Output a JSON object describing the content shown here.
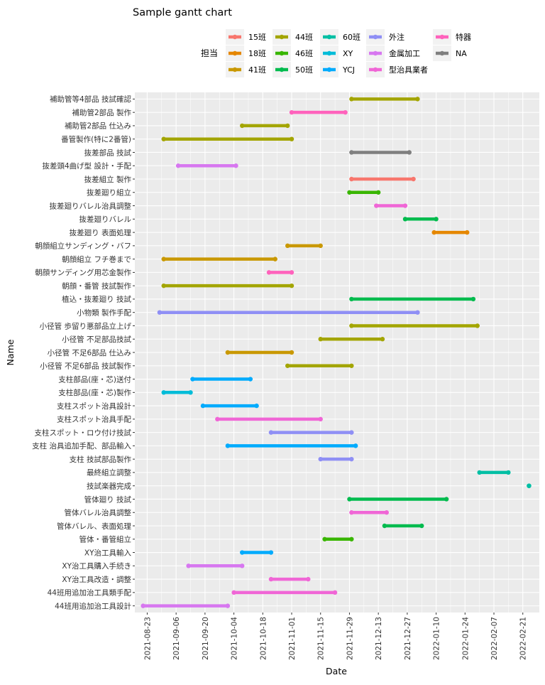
{
  "chart_data": {
    "type": "gantt",
    "title": "Sample gantt chart",
    "xlabel": "Date",
    "ylabel": "Name",
    "legend_title": "担当",
    "legend_position": "top",
    "grid": true,
    "xlim": [
      "2021-08-17",
      "2022-03-01"
    ],
    "x_ticks": [
      "2021-08-23",
      "2021-09-06",
      "2021-09-20",
      "2021-10-04",
      "2021-10-18",
      "2021-11-01",
      "2021-11-15",
      "2021-11-29",
      "2021-12-13",
      "2021-12-27",
      "2022-01-10",
      "2022-01-24",
      "2022-02-07",
      "2022-02-21"
    ],
    "legend": [
      {
        "name": "15班",
        "color": "#F8766D"
      },
      {
        "name": "18班",
        "color": "#E58700"
      },
      {
        "name": "41班",
        "color": "#C99800"
      },
      {
        "name": "44班",
        "color": "#A3A500"
      },
      {
        "name": "46班",
        "color": "#39B600"
      },
      {
        "name": "50班",
        "color": "#00BB4E"
      },
      {
        "name": "60班",
        "color": "#00BFA4"
      },
      {
        "name": "XY",
        "color": "#00BCD8"
      },
      {
        "name": "YCJ",
        "color": "#00ABFD"
      },
      {
        "name": "外注",
        "color": "#8F8FF5"
      },
      {
        "name": "金属加工",
        "color": "#D777F0"
      },
      {
        "name": "型治具業者",
        "color": "#F066D6"
      },
      {
        "name": "特器",
        "color": "#FF62BC"
      },
      {
        "name": "NA",
        "color": "#7F7F7F"
      }
    ],
    "tasks": [
      {
        "name": "補助管等4部品 技試確認",
        "start": "2021-11-30",
        "end": "2022-01-01",
        "group": "44班"
      },
      {
        "name": "補助管2部品 製作",
        "start": "2021-11-01",
        "end": "2021-11-27",
        "group": "特器"
      },
      {
        "name": "補助管2部品 仕込み",
        "start": "2021-10-08",
        "end": "2021-10-30",
        "group": "44班"
      },
      {
        "name": "番管製作(特に2番管)",
        "start": "2021-08-31",
        "end": "2021-11-01",
        "group": "44班"
      },
      {
        "name": "抜差部品 技試",
        "start": "2021-11-30",
        "end": "2021-12-28",
        "group": "NA"
      },
      {
        "name": "抜差頭4曲げ型 設計・手配",
        "start": "2021-09-07",
        "end": "2021-10-05",
        "group": "金属加工"
      },
      {
        "name": "抜差組立 製作",
        "start": "2021-11-30",
        "end": "2021-12-30",
        "group": "15班"
      },
      {
        "name": "抜差廻り組立",
        "start": "2021-11-29",
        "end": "2021-12-13",
        "group": "46班"
      },
      {
        "name": "抜差廻りバレル治具調整",
        "start": "2021-12-12",
        "end": "2021-12-26",
        "group": "型治具業者"
      },
      {
        "name": "抜差廻りバレル",
        "start": "2021-12-26",
        "end": "2022-01-10",
        "group": "50班"
      },
      {
        "name": "抜差廻り 表面処理",
        "start": "2022-01-09",
        "end": "2022-01-25",
        "group": "18班"
      },
      {
        "name": "朝顔組立サンディング・バフ",
        "start": "2021-10-30",
        "end": "2021-11-15",
        "group": "41班"
      },
      {
        "name": "朝顔組立 フチ巻まで",
        "start": "2021-08-31",
        "end": "2021-10-24",
        "group": "41班"
      },
      {
        "name": "朝顔サンディング用芯金製作",
        "start": "2021-10-21",
        "end": "2021-11-01",
        "group": "特器"
      },
      {
        "name": "朝顔・番管 技試製作",
        "start": "2021-08-31",
        "end": "2021-11-01",
        "group": "44班"
      },
      {
        "name": "植込・抜差廻り 技試",
        "start": "2021-11-30",
        "end": "2022-01-28",
        "group": "50班"
      },
      {
        "name": "小物類 製作手配",
        "start": "2021-08-29",
        "end": "2022-01-01",
        "group": "外注"
      },
      {
        "name": "小径管 歩留り悪部品立上げ",
        "start": "2021-11-30",
        "end": "2022-01-30",
        "group": "44班"
      },
      {
        "name": "小径管 不足部品技試",
        "start": "2021-11-15",
        "end": "2021-12-15",
        "group": "44班"
      },
      {
        "name": "小径管 不足6部品 仕込み",
        "start": "2021-10-01",
        "end": "2021-11-01",
        "group": "41班"
      },
      {
        "name": "小径管 不足6部品 技試製作",
        "start": "2021-10-30",
        "end": "2021-11-30",
        "group": "44班"
      },
      {
        "name": "支柱部品(座・芯)送付",
        "start": "2021-09-14",
        "end": "2021-10-12",
        "group": "YCJ"
      },
      {
        "name": "支柱部品(座・芯)製作",
        "start": "2021-08-31",
        "end": "2021-09-13",
        "group": "XY"
      },
      {
        "name": "支柱スポット治具設計",
        "start": "2021-09-19",
        "end": "2021-10-15",
        "group": "YCJ"
      },
      {
        "name": "支柱スポット治具手配",
        "start": "2021-09-26",
        "end": "2021-11-15",
        "group": "型治具業者"
      },
      {
        "name": "支柱スポット・ロウ付け技試",
        "start": "2021-10-22",
        "end": "2021-11-30",
        "group": "外注"
      },
      {
        "name": "支柱 治具追加手配、部品輸入",
        "start": "2021-10-01",
        "end": "2021-12-02",
        "group": "YCJ"
      },
      {
        "name": "支柱 技試部品製作",
        "start": "2021-11-15",
        "end": "2021-11-30",
        "group": "外注"
      },
      {
        "name": "最終組立調整",
        "start": "2022-01-31",
        "end": "2022-02-14",
        "group": "60班"
      },
      {
        "name": "技試楽器完成",
        "start": "2022-02-24",
        "end": "2022-02-24",
        "group": "60班"
      },
      {
        "name": "管体廻り 技試",
        "start": "2021-11-29",
        "end": "2022-01-15",
        "group": "50班"
      },
      {
        "name": "管体バレル治具調整",
        "start": "2021-11-30",
        "end": "2021-12-17",
        "group": "型治具業者"
      },
      {
        "name": "管体バレル、表面処理",
        "start": "2021-12-16",
        "end": "2022-01-03",
        "group": "50班"
      },
      {
        "name": "管体・番管組立",
        "start": "2021-11-17",
        "end": "2021-11-30",
        "group": "46班"
      },
      {
        "name": "XY治工具輸入",
        "start": "2021-10-08",
        "end": "2021-10-22",
        "group": "YCJ"
      },
      {
        "name": "XY治工具購入手続き",
        "start": "2021-09-12",
        "end": "2021-10-08",
        "group": "金属加工"
      },
      {
        "name": "XY治工具改造・調整",
        "start": "2021-10-22",
        "end": "2021-11-09",
        "group": "型治具業者"
      },
      {
        "name": "44班用追加治工具類手配",
        "start": "2021-10-04",
        "end": "2021-11-22",
        "group": "型治具業者"
      },
      {
        "name": "44班用追加治工具設計",
        "start": "2021-08-21",
        "end": "2021-10-01",
        "group": "金属加工"
      }
    ]
  }
}
